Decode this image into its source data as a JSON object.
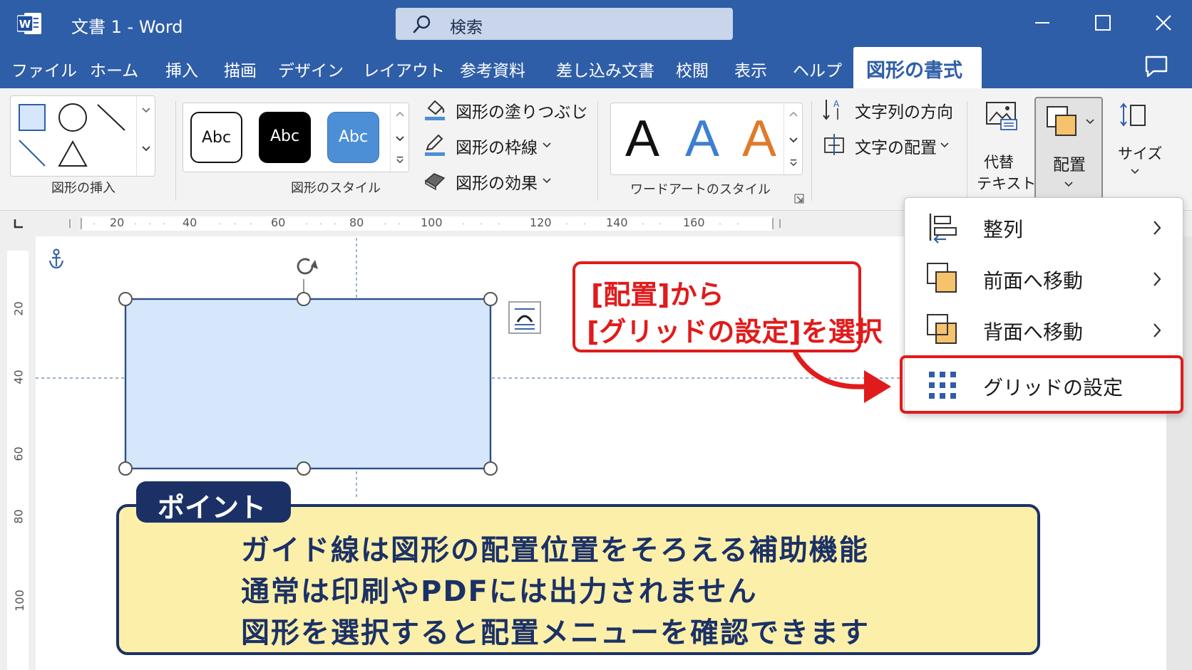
{
  "window": {
    "title": "文書 1  -  Word",
    "search_placeholder": "検索"
  },
  "tabs": [
    "ファイル",
    "ホーム",
    "挿入",
    "描画",
    "デザイン",
    "レイアウト",
    "参考資料",
    "差し込み文書",
    "校閲",
    "表示",
    "ヘルプ"
  ],
  "active_tab": "図形の書式",
  "ribbon": {
    "insert_shapes": {
      "label": "図形の挿入"
    },
    "shape_styles": {
      "label": "図形のスタイル",
      "presets": [
        "Abc",
        "Abc",
        "Abc"
      ],
      "fill": "図形の塗りつぶし",
      "outline": "図形の枠線",
      "effects": "図形の効果"
    },
    "wordart": {
      "label": "ワードアートのスタイル",
      "glyphs": [
        "A",
        "A",
        "A"
      ]
    },
    "text": {
      "direction": "文字列の方向",
      "align": "文字の配置"
    },
    "alt_text": {
      "line1": "代替",
      "line2": "テキスト"
    },
    "arrange": {
      "label": "配置"
    },
    "size": {
      "label": "サイズ"
    }
  },
  "ruler": {
    "horizontal": [
      "20",
      "40",
      "60",
      "80",
      "100",
      "120",
      "140",
      "160"
    ],
    "vertical": [
      "20",
      "40",
      "60",
      "80",
      "100"
    ]
  },
  "arrange_menu": {
    "items": [
      {
        "label": "整列",
        "has_submenu": true
      },
      {
        "label": "前面へ移動",
        "has_submenu": true
      },
      {
        "label": "背面へ移動",
        "has_submenu": true
      },
      {
        "label": "グリッドの設定",
        "has_submenu": false
      }
    ]
  },
  "callout": {
    "line1": "[配置]から",
    "line2": "[グリッドの設定]を選択"
  },
  "point": {
    "tag": "ポイント",
    "lines": [
      "ガイド線は図形の配置位置をそろえる補助機能",
      "通常は印刷やPDFには出力されません",
      "図形を選択すると配置メニューを確認できます"
    ]
  },
  "colors": {
    "titlebar": "#2f5ea8",
    "accent_red": "#e11b1b",
    "point_navy": "#1b3166",
    "point_bg": "#fcefa9",
    "shape_fill": "#d6e7fb"
  }
}
